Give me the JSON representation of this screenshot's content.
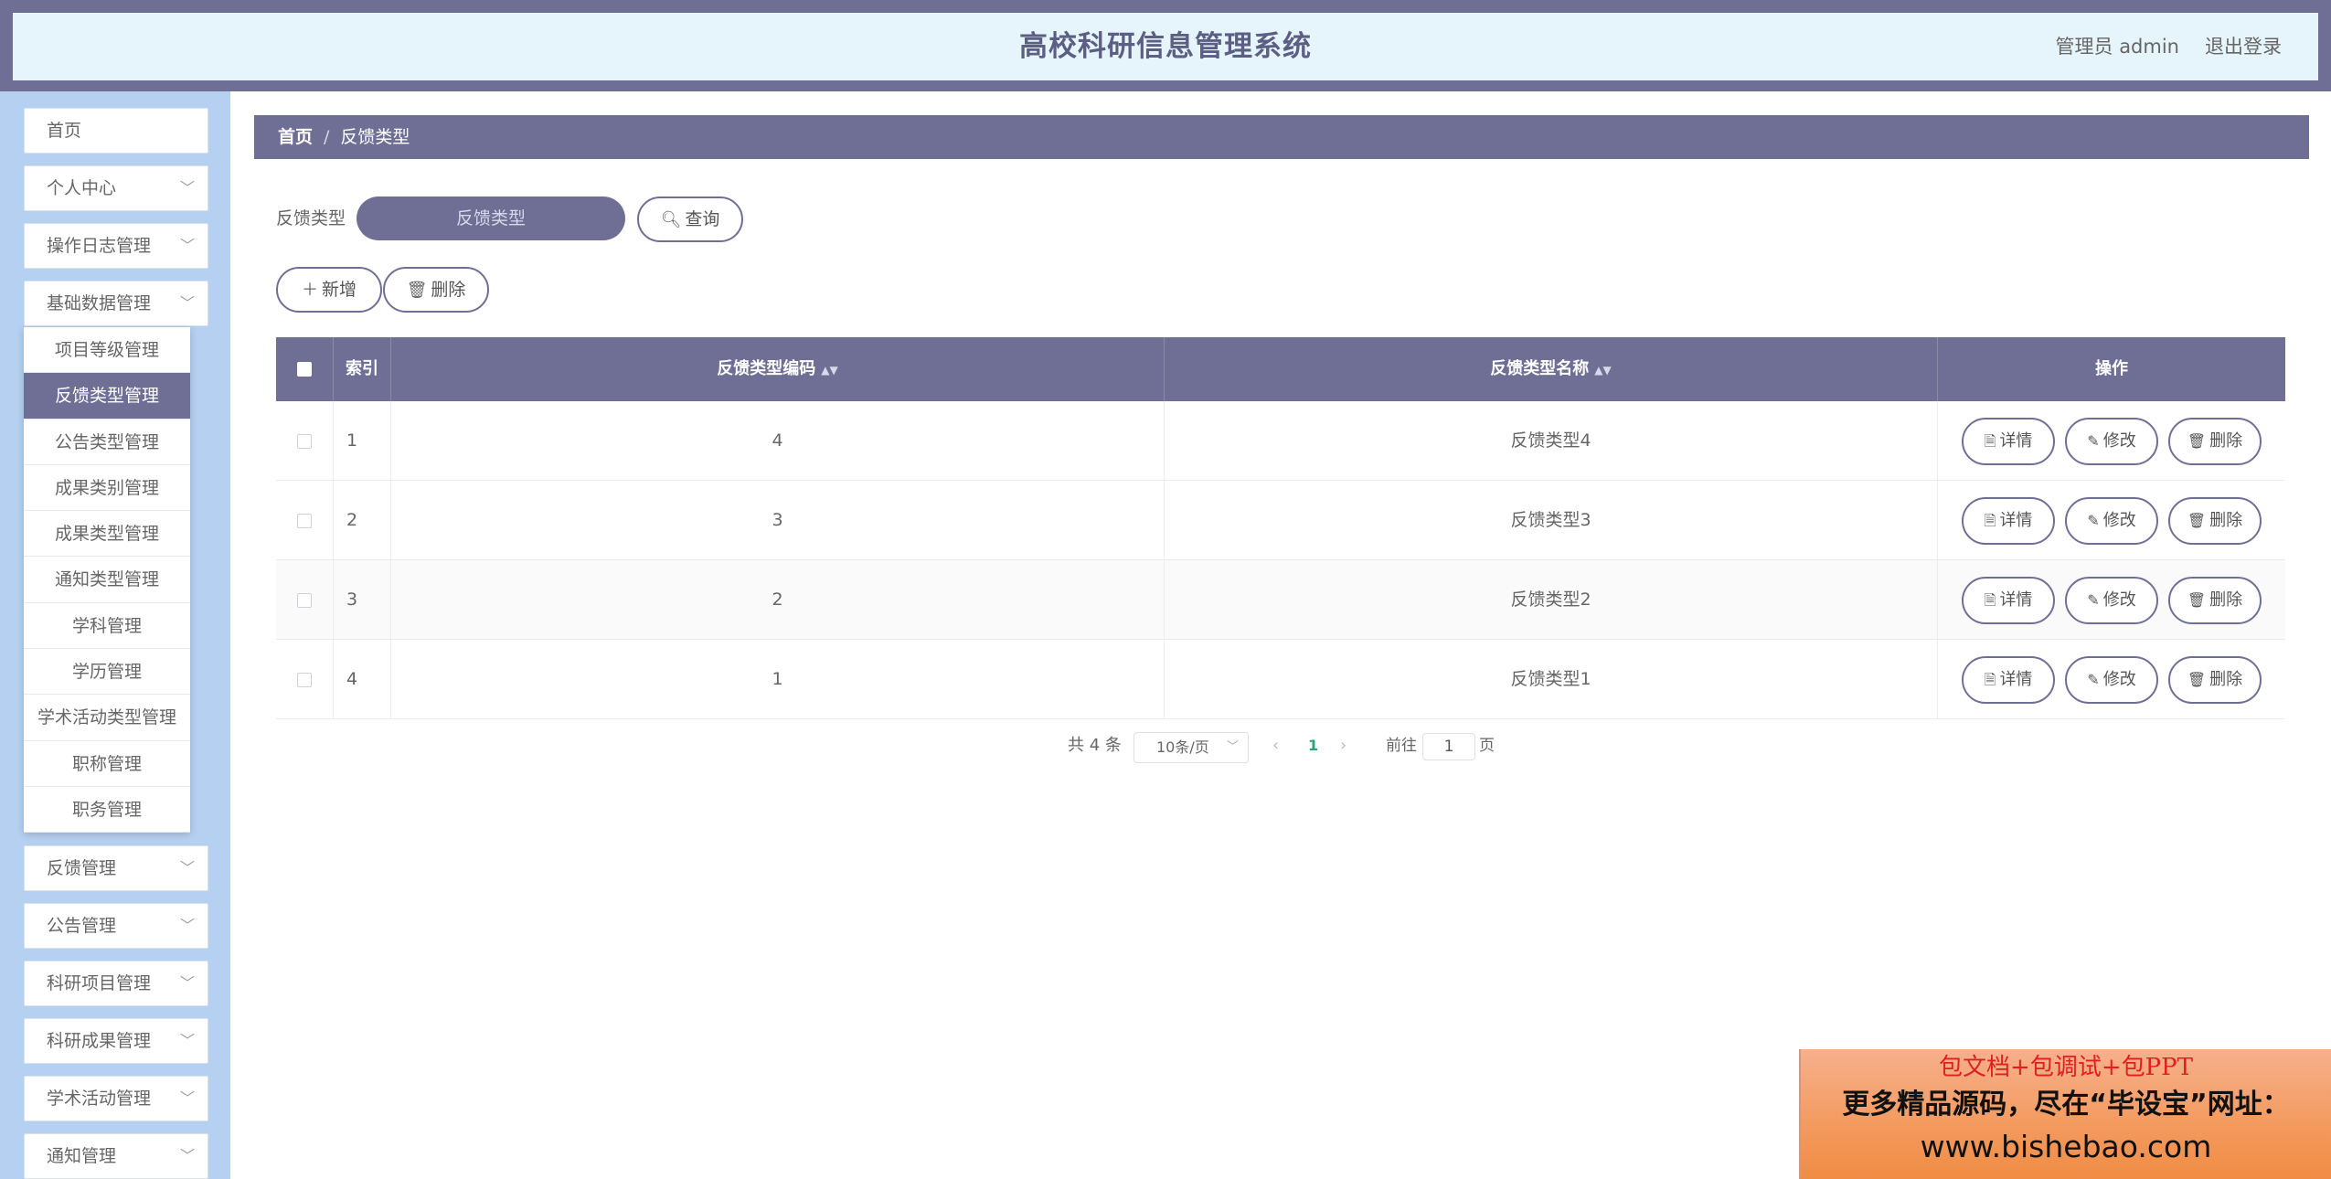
{
  "header": {
    "title": "高校科研信息管理系统",
    "user": "管理员 admin",
    "logout": "退出登录"
  },
  "sidebar": {
    "items": [
      {
        "label": "首页",
        "has_children": false
      },
      {
        "label": "个人中心",
        "has_children": true
      },
      {
        "label": "操作日志管理",
        "has_children": true
      },
      {
        "label": "基础数据管理",
        "has_children": true
      },
      {
        "label": "反馈管理",
        "has_children": true
      },
      {
        "label": "公告管理",
        "has_children": true
      },
      {
        "label": "科研项目管理",
        "has_children": true
      },
      {
        "label": "科研成果管理",
        "has_children": true
      },
      {
        "label": "学术活动管理",
        "has_children": true
      },
      {
        "label": "通知管理",
        "has_children": true
      }
    ],
    "submenu": [
      {
        "label": "项目等级管理",
        "active": false
      },
      {
        "label": "反馈类型管理",
        "active": true
      },
      {
        "label": "公告类型管理",
        "active": false
      },
      {
        "label": "成果类别管理",
        "active": false
      },
      {
        "label": "成果类型管理",
        "active": false
      },
      {
        "label": "通知类型管理",
        "active": false
      },
      {
        "label": "学科管理",
        "active": false
      },
      {
        "label": "学历管理",
        "active": false
      },
      {
        "label": "学术活动类型管理",
        "active": false
      },
      {
        "label": "职称管理",
        "active": false
      },
      {
        "label": "职务管理",
        "active": false
      }
    ]
  },
  "breadcrumb": {
    "home": "首页",
    "separator": "/",
    "current": "反馈类型"
  },
  "search": {
    "label": "反馈类型",
    "placeholder": "反馈类型",
    "value": "",
    "button": "查询"
  },
  "toolbar": {
    "add": "新增",
    "delete": "删除"
  },
  "table": {
    "headers": {
      "index": "索引",
      "code": "反馈类型编码",
      "name": "反馈类型名称",
      "actions": "操作"
    },
    "rows": [
      {
        "index": "1",
        "code": "4",
        "name": "反馈类型4"
      },
      {
        "index": "2",
        "code": "3",
        "name": "反馈类型3"
      },
      {
        "index": "3",
        "code": "2",
        "name": "反馈类型2"
      },
      {
        "index": "4",
        "code": "1",
        "name": "反馈类型1"
      }
    ],
    "row_actions": {
      "detail": "详情",
      "edit": "修改",
      "delete": "删除"
    }
  },
  "pagination": {
    "total": "共 4 条",
    "page_size": "10条/页",
    "current_page": "1",
    "goto_prefix": "前往",
    "goto_value": "1",
    "goto_suffix": "页"
  },
  "watermark": {
    "line1": "包文档+包调试+包PPT",
    "line2": "更多精品源码，尽在“毕设宝”网址：",
    "line3": "www.bishebao.com"
  },
  "colors": {
    "primary": "#6f6f96",
    "header_bg": "#e6f5fb",
    "sidebar_bg": "#b6d0f1",
    "page_link": "#21a67a"
  }
}
